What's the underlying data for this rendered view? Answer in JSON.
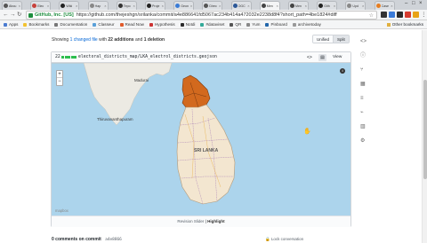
{
  "browser": {
    "tabs": [
      {
        "label": "Abou"
      },
      {
        "label": "Elec"
      },
      {
        "label": "Wiki"
      },
      {
        "label": "Hap"
      },
      {
        "label": "Tepo"
      },
      {
        "label": "Proje"
      },
      {
        "label": "Geon"
      },
      {
        "label": "Direc"
      },
      {
        "label": "OGC"
      },
      {
        "label": "Men"
      },
      {
        "label": "Men"
      },
      {
        "label": "Gith"
      },
      {
        "label": "Upd"
      },
      {
        "label": "Case"
      }
    ],
    "address": {
      "secure_label": "GitHub, Inc. [US]",
      "url": "https://github.com/thejeshgn/srilanka/commit/a4e886641fd5067ac234b414a472032e2238d8f4?short_path=4be1824#diff"
    }
  },
  "bookmarks": [
    {
      "label": "Apps"
    },
    {
      "label": "Bookmarks"
    },
    {
      "label": "Documentation"
    },
    {
      "label": "Classeur"
    },
    {
      "label": "Read Now"
    },
    {
      "label": "Hypothesis"
    },
    {
      "label": "Notdi"
    },
    {
      "label": "#dataviset"
    },
    {
      "label": "QR"
    },
    {
      "label": "Yum"
    },
    {
      "label": "Pinboard"
    },
    {
      "label": "archivetoday"
    }
  ],
  "bookmarks_other": "Other bookmarks",
  "diff": {
    "showing": "Showing",
    "changed_files": "1 changed file",
    "with": "with",
    "additions": "22 additions",
    "and": "and",
    "deletions": "1 deletion",
    "unified_label": "Unified",
    "split_label": "Split"
  },
  "file": {
    "count": "22",
    "name": "electoral_districts_map/LKA_electrol_districts.geojson",
    "view_label": "View",
    "footer_revision": "Revision Slider",
    "footer_sep": "|",
    "footer_highlight": "Highlight"
  },
  "map": {
    "labels": {
      "madurai": "Madurai",
      "thiruvananthapuram": "Thiruvananthapuram",
      "sri_lanka": "SRI LANKA"
    },
    "zoom_in": "+",
    "zoom_out": "−",
    "info": "i",
    "logo": "mapbox",
    "highlight_color": "#d2691e",
    "district_fill": "#f3e6d0",
    "sea_color": "#acd4ec"
  },
  "comments": {
    "text": "0 comments on commit",
    "sha": "a4e8866"
  },
  "lock_conversation": "Lock conversation"
}
